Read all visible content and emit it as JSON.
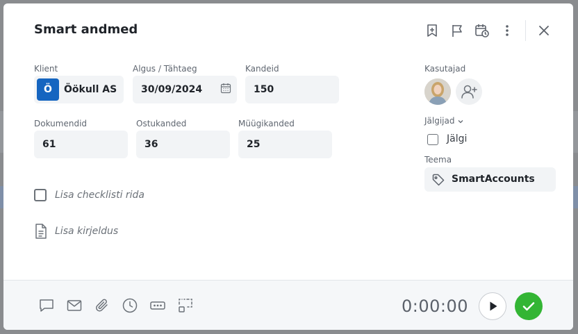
{
  "title": "Smart andmed",
  "fields": {
    "client_label": "Klient",
    "client_initial": "Ö",
    "client_value": "Öökull AS",
    "dates_label": "Algus / Tähtaeg",
    "date_value": "30/09/2024",
    "entries_label": "Kandeid",
    "entries_value": "150",
    "documents_label": "Dokumendid",
    "documents_value": "61",
    "purchases_label": "Ostukanded",
    "purchases_value": "36",
    "sales_label": "Müügikanded",
    "sales_value": "25"
  },
  "checklist_placeholder": "Lisa checklisti rida",
  "description_placeholder": "Lisa kirjeldus",
  "sidebar": {
    "users_label": "Kasutajad",
    "followers_label": "Jälgijad",
    "follow_label": "Jälgi",
    "theme_label": "Teema",
    "theme_value": "SmartAccounts"
  },
  "footer": {
    "timer": "0:00:00"
  },
  "colors": {
    "client_badge": "#1565c0",
    "done": "#33b534"
  }
}
